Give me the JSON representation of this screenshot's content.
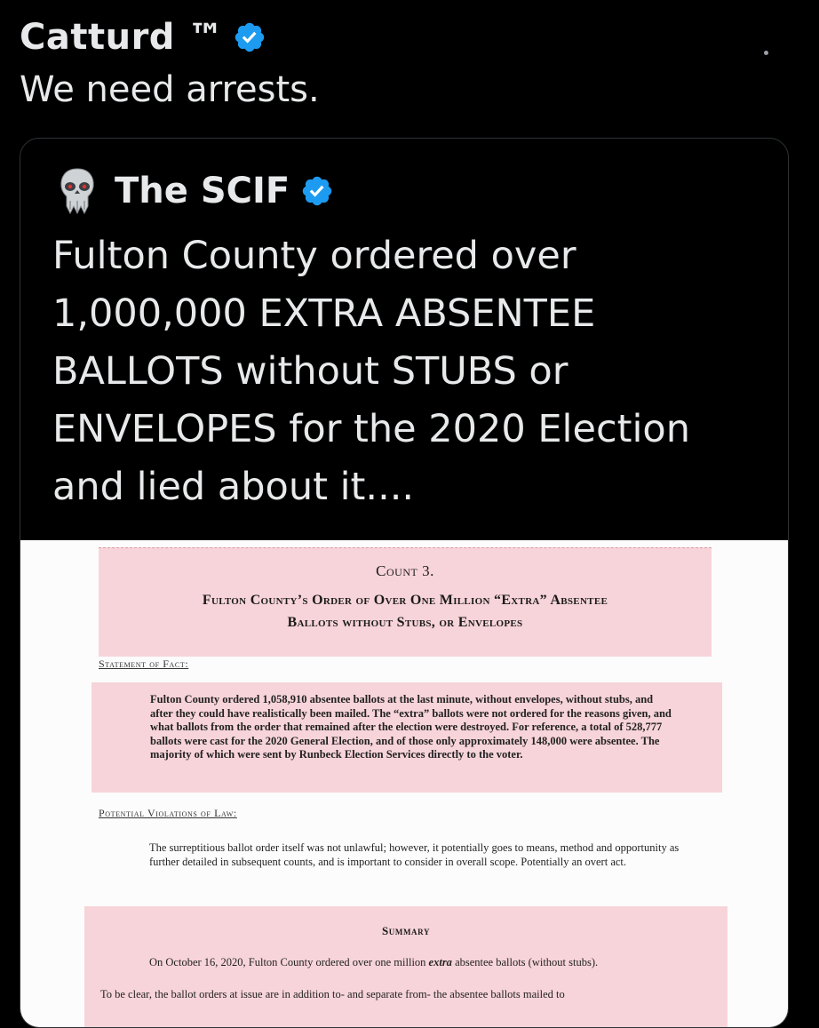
{
  "tweet": {
    "author": "Catturd ™",
    "verified_icon": "verified-badge-icon",
    "text": "We need arrests."
  },
  "quote": {
    "author": "The SCIF",
    "avatar_icon": "punisher-skull-icon",
    "verified_icon": "verified-badge-icon",
    "text": "Fulton County ordered over\n1,000,000 EXTRA  ABSENTEE\nBALLOTS without STUBS or\nENVELOPES for the 2020 Election\nand lied about it...."
  },
  "document": {
    "count_title": "Count 3.",
    "count_subtitle_line1": "Fulton County’s Order of Over One Million “Extra” Absentee",
    "count_subtitle_line2": "Ballots without Stubs, or Envelopes",
    "statement_label": "Statement of Fact:",
    "fact_text": "Fulton County ordered 1,058,910 absentee ballots at the last minute, without envelopes, without stubs, and after they could have realistically been mailed. The “extra” ballots were not ordered for the reasons given, and what ballots from the order that remained after the election were destroyed. For reference, a total of 528,777 ballots were cast for the 2020 General Election, and of those only approximately 148,000 were absentee. The majority of which were sent by Runbeck Election Services directly to the voter.",
    "violations_label": "Potential Violations of Law:",
    "violation_text": "The surreptitious ballot order itself was not unlawful; however, it potentially goes to means, method and opportunity as further detailed in subsequent counts, and is important to consider in overall scope. Potentially an overt act.",
    "summary_title": "Summary",
    "summary_line1_a": "On October 16, 2020, Fulton County ordered over one million ",
    "summary_line1_em": "extra",
    "summary_line1_b": " absentee ballots (without stubs).",
    "summary_line2": "To be clear, the ballot orders at issue are in addition to- and separate from- the absentee ballots mailed to"
  },
  "colors": {
    "background": "#000000",
    "verified_blue": "#1d9bf0",
    "highlight_pink": "#f7d4d9"
  }
}
